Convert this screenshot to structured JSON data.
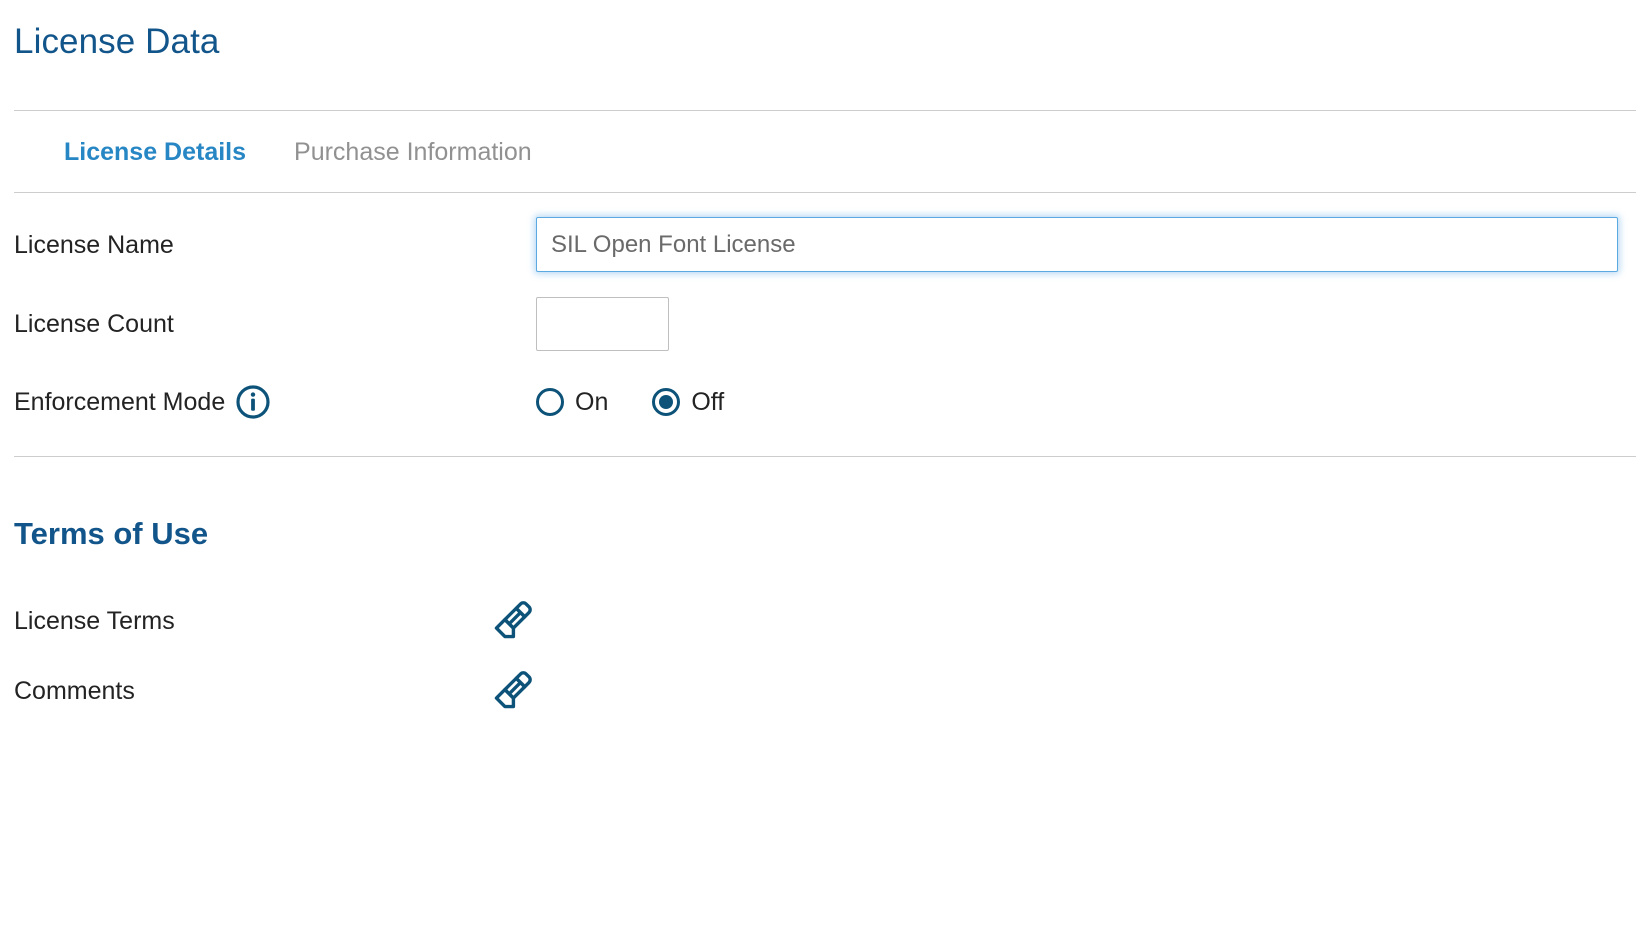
{
  "page": {
    "title": "License Data"
  },
  "tabs": [
    {
      "label": "License Details",
      "active": true
    },
    {
      "label": "Purchase Information",
      "active": false
    }
  ],
  "license_details": {
    "fields": [
      {
        "label": "License Name",
        "type": "text",
        "value": "",
        "placeholder": "SIL Open Font License",
        "focused": true
      },
      {
        "label": "License Count",
        "type": "text",
        "value": "",
        "placeholder": "",
        "focused": false
      }
    ],
    "enforcement_mode": {
      "label": "Enforcement Mode",
      "info_icon": "info-circle-icon",
      "options": [
        {
          "label": "On",
          "selected": false
        },
        {
          "label": "Off",
          "selected": true
        }
      ]
    }
  },
  "terms_of_use": {
    "title": "Terms of Use",
    "rows": [
      {
        "label": "License Terms",
        "action_icon": "pencil-edit-icon"
      },
      {
        "label": "Comments",
        "action_icon": "pencil-edit-icon"
      }
    ]
  },
  "colors": {
    "heading_blue": "#12558a",
    "tab_active_blue": "#2786c4",
    "tab_inactive_gray": "#919191",
    "icon_blue": "#0d5379",
    "focus_border": "#5aa9e0",
    "divider": "#cdcdcd",
    "input_border": "#bfbfbf",
    "text": "#232323"
  }
}
